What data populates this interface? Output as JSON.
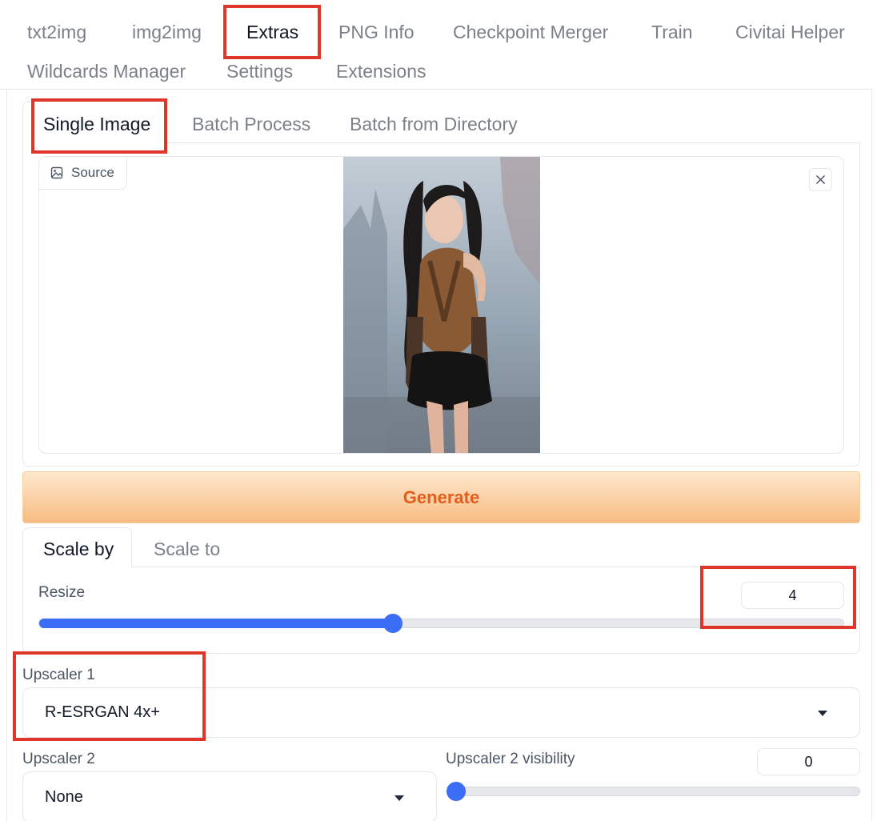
{
  "main_tabs": [
    "txt2img",
    "img2img",
    "Extras",
    "PNG Info",
    "Checkpoint Merger",
    "Train",
    "Civitai Helper",
    "Wildcards Manager",
    "Settings",
    "Extensions"
  ],
  "active_main_tab": "Extras",
  "sub_tabs": [
    "Single Image",
    "Batch Process",
    "Batch from Directory"
  ],
  "active_sub_tab": "Single Image",
  "source": {
    "label": "Source"
  },
  "generate_label": "Generate",
  "scale_tabs": [
    "Scale by",
    "Scale to"
  ],
  "resize": {
    "label": "Resize",
    "value": "4",
    "fraction": 0.44
  },
  "upscaler1": {
    "label": "Upscaler 1",
    "value": "R-ESRGAN 4x+"
  },
  "upscaler2": {
    "label": "Upscaler 2",
    "value": "None"
  },
  "upscaler2_visibility": {
    "label": "Upscaler 2 visibility",
    "value": "0",
    "fraction": 0.0
  },
  "colors": {
    "accent": "#3b6ef5",
    "generate_text": "#e35e1c",
    "highlight": "#e0352b"
  }
}
